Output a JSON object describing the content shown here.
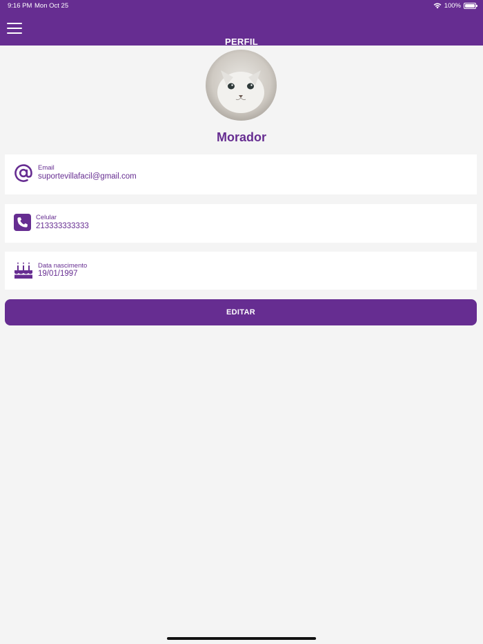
{
  "status_bar": {
    "time": "9:16 PM",
    "date": "Mon Oct 25",
    "battery": "100%"
  },
  "header": {
    "title": "PERFIL"
  },
  "profile": {
    "name": "Morador"
  },
  "fields": [
    {
      "label": "Email",
      "value": "suportevillafacil@gmail.com",
      "icon": "at-icon"
    },
    {
      "label": "Celular",
      "value": "213333333333",
      "icon": "phone-icon"
    },
    {
      "label": "Data nascimento",
      "value": "19/01/1997",
      "icon": "cake-icon"
    }
  ],
  "actions": {
    "edit_label": "EDITAR"
  },
  "colors": {
    "primary": "#662d91",
    "background": "#f4f4f4",
    "card": "#ffffff"
  }
}
